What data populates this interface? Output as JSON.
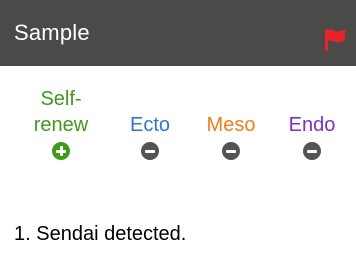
{
  "header": {
    "title": "Sample",
    "flag_icon": "red-flag-icon",
    "background_color": "#4a4a49",
    "flag_color": "#e8232a"
  },
  "markers": [
    {
      "label_line1": "Self-",
      "label_line2": "renew",
      "color": "#3f9a1c",
      "icon": "plus-circle-icon"
    },
    {
      "label_line1": "",
      "label_line2": "Ecto",
      "color": "#2f77d0",
      "icon": "minus-circle-icon"
    },
    {
      "label_line1": "",
      "label_line2": "Meso",
      "color": "#f07d1c",
      "icon": "minus-circle-icon"
    },
    {
      "label_line1": "",
      "label_line2": "Endo",
      "color": "#7d2fd1",
      "icon": "minus-circle-icon"
    }
  ],
  "icon_color_inactive": "#545454",
  "icon_color_active": "#3f9a1c",
  "result": {
    "text": "1. Sendai detected."
  }
}
